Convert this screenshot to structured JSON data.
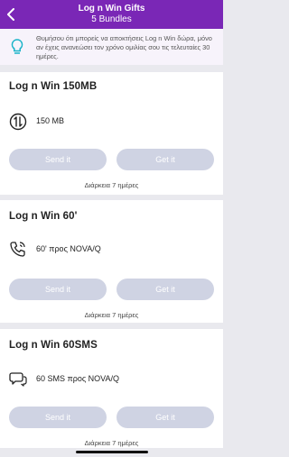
{
  "header": {
    "title": "Log n Win Gifts",
    "subtitle": "5 Bundles",
    "bg_color": "#7a27b6"
  },
  "info": {
    "text": "Θυμήσου ότι μπορείς να αποκτήσεις Log n Win δώρα, μόνο αν έχεις ανανεώσει τον χρόνο ομιλίας σου τις τελευταίες 30 ημέρες.",
    "icon": "lightbulb-icon",
    "icon_color": "#19b3c8"
  },
  "cards": [
    {
      "title": "Log n Win 150MB",
      "icon": "data-arrows-icon",
      "desc": "150 MB",
      "send_label": "Send it",
      "get_label": "Get it",
      "duration": "Διάρκεια 7 ημέρες"
    },
    {
      "title": "Log n Win 60'",
      "icon": "phone-icon",
      "desc": "60' προς NOVA/Q",
      "send_label": "Send it",
      "get_label": "Get it",
      "duration": "Διάρκεια 7 ημέρες"
    },
    {
      "title": "Log n Win 60SMS",
      "icon": "chat-bubbles-icon",
      "desc": "60 SMS προς NOVA/Q",
      "send_label": "Send it",
      "get_label": "Get it",
      "duration": "Διάρκεια 7 ημέρες"
    }
  ],
  "colors": {
    "button_disabled": "#cfd3e3",
    "page_bg": "#e9e9ee"
  }
}
